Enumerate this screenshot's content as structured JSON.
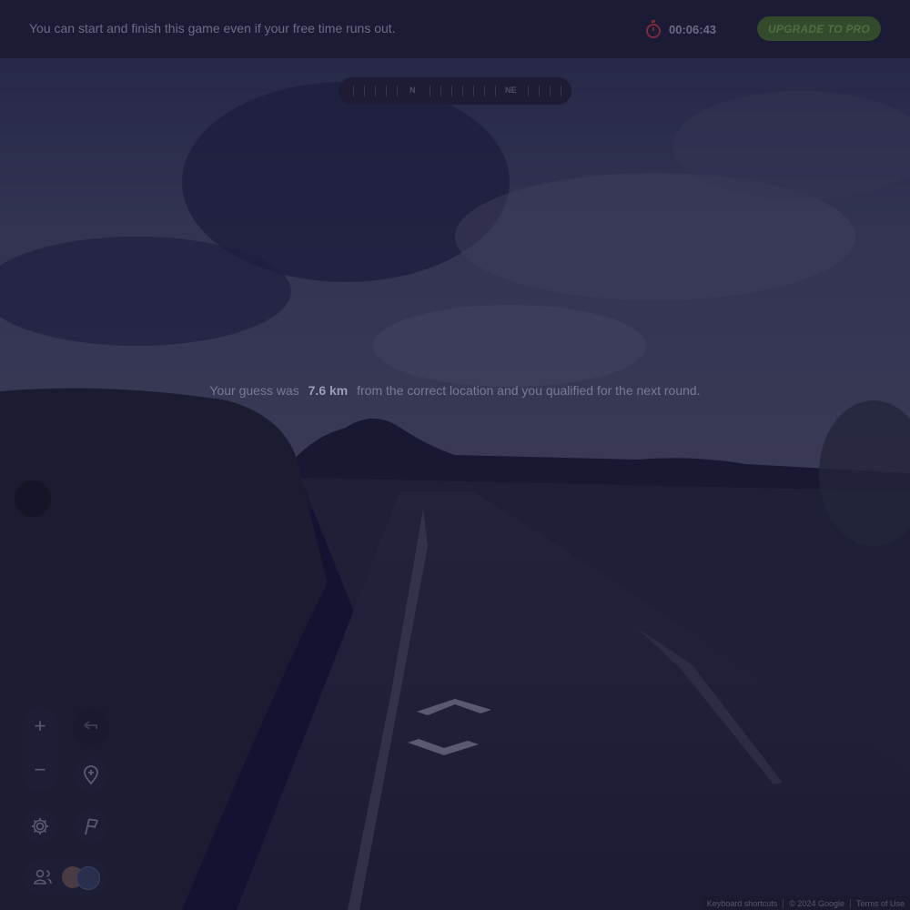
{
  "banner": {
    "message": "You can start and finish this game even if your free time runs out.",
    "timer_icon": "stopwatch-icon",
    "timer": "00:06:43",
    "upgrade_label": "UPGRADE TO PRO"
  },
  "compass": {
    "north": "N",
    "northeast": "NE"
  },
  "result": {
    "prefix": "Your guess was",
    "distance": "7.6 km",
    "suffix": "from the correct location and you qualified for the next round."
  },
  "controls": {
    "zoom_in": "+",
    "zoom_out": "−",
    "icons": [
      "undo-icon",
      "pin-plus-icon",
      "gear-icon",
      "flag-icon",
      "people-icon"
    ]
  },
  "footer": {
    "shortcuts": "Keyboard shortcuts",
    "copyright": "© 2024 Google",
    "terms": "Terms of Use"
  },
  "colors": {
    "overlay": "#1c1b36",
    "upgrade": "#344a2c",
    "timer_icon": "#7a2a3a"
  }
}
